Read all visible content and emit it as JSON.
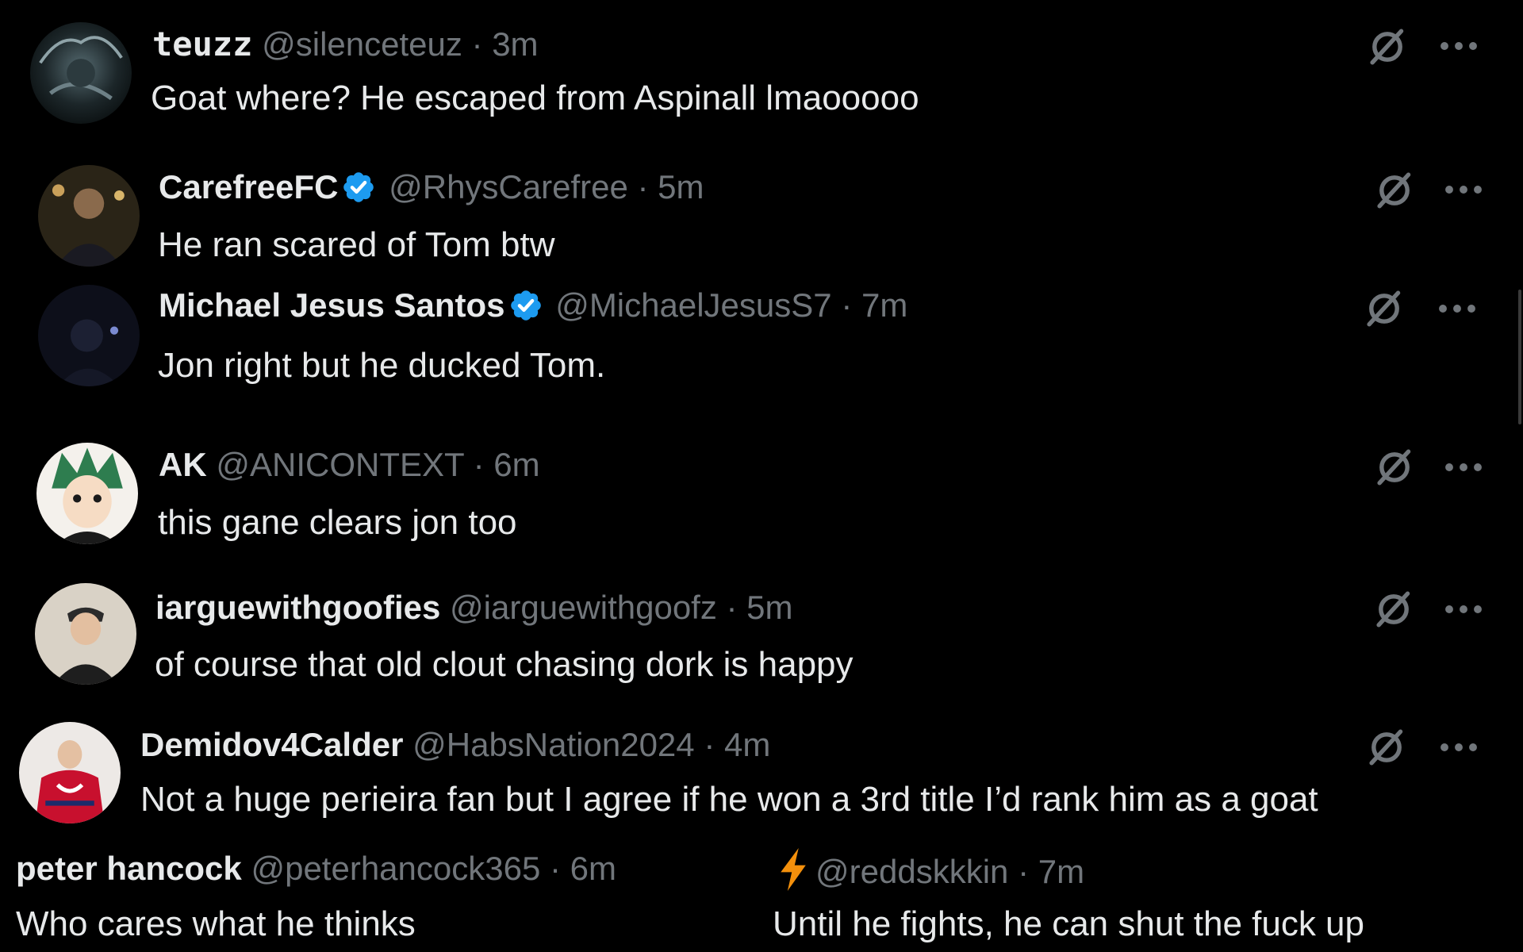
{
  "colors": {
    "background": "#000000",
    "text_primary": "#e7e9ea",
    "text_secondary": "#71767b",
    "verified_blue": "#1d9bf0",
    "bolt_orange": "#f4900c"
  },
  "posts": [
    {
      "display_name": "teuzz",
      "handle": "@silenceteuz",
      "time": "· 3m",
      "text": "Goat where? He escaped from Aspinall lmaooooo",
      "verified": false,
      "icons": [
        "grok-icon",
        "more-icon"
      ]
    },
    {
      "display_name": "CarefreeFC",
      "handle": "@RhysCarefree",
      "time": "· 5m",
      "text": "He ran scared of Tom btw",
      "verified": true,
      "icons": [
        "verified-badge-icon",
        "grok-icon",
        "more-icon"
      ]
    },
    {
      "display_name": "Michael Jesus Santos",
      "handle": "@MichaelJesusS7",
      "time": "· 7m",
      "text": "Jon right but he ducked Tom.",
      "verified": true,
      "icons": [
        "verified-badge-icon",
        "grok-icon",
        "more-icon"
      ]
    },
    {
      "display_name": "AK",
      "handle": "@ANICONTEXT",
      "time": "· 6m",
      "text": "this gane clears jon too",
      "verified": false,
      "icons": [
        "grok-icon",
        "more-icon"
      ]
    },
    {
      "display_name": "iarguewithgoofies",
      "handle": "@iarguewithgoofz",
      "time": "· 5m",
      "text": "of course that old clout chasing dork is happy",
      "verified": false,
      "icons": [
        "grok-icon",
        "more-icon"
      ]
    },
    {
      "display_name": "Demidov4Calder",
      "handle": "@HabsNation2024",
      "time": "· 4m",
      "text": "Not a huge perieira fan but I agree if he won a 3rd title I’d rank him as a goat",
      "verified": false,
      "icons": [
        "grok-icon",
        "more-icon"
      ]
    },
    {
      "display_name": "peter hancock",
      "handle": "@peterhancock365",
      "time": "· 6m",
      "text": "Who cares what he thinks",
      "verified": false,
      "icons": []
    },
    {
      "display_name": "",
      "handle": "@reddskkkin",
      "time": "· 7m",
      "text": "Until he fights, he can shut the fuck up",
      "verified": false,
      "icons": [
        "lightning-bolt-icon"
      ]
    }
  ]
}
